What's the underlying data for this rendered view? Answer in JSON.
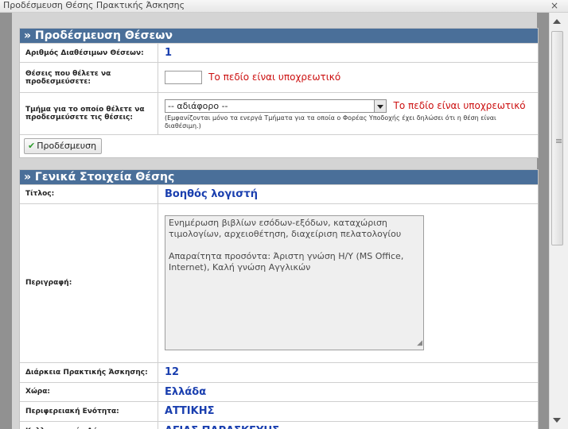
{
  "window": {
    "title": "Προδέσμευση Θέσης Πρακτικής Άσκησης",
    "close": "×"
  },
  "panel1": {
    "header": "» Προδέσμευση Θέσεων",
    "rows": [
      {
        "label": "Αριθμός Διαθέσιμων Θέσεων:",
        "value": "1"
      },
      {
        "label": "Θέσεις που θέλετε να προδεσμεύσετε:",
        "required": "Το πεδίο είναι υποχρεωτικό"
      },
      {
        "label": "Τμήμα για το οποίο θέλετε να προδεσμεύσετε τις θέσεις:",
        "select_value": "-- αδιάφορο --",
        "required": "Το πεδίο είναι υποχρεωτικό",
        "hint": "(Εμφανίζονται μόνο τα ενεργά Τμήματα για τα οποία ο Φορέας Υποδοχής έχει δηλώσει ότι η θέση είναι διαθέσιμη.)"
      }
    ],
    "button": "Προδέσμευση",
    "button_icon": "check-icon"
  },
  "panel2": {
    "header": "» Γενικά Στοιχεία Θέσης",
    "title_label": "Τίτλος:",
    "title_value": "Βοηθός λογιστή",
    "desc_label": "Περιγραφή:",
    "desc_value": "Ενημέρωση βιβλίων εσόδων-εξόδων, καταχώριση τιμολογίων, αρχειοθέτηση, διαχείριση πελατολογίου\n\nΑπαραίτητα προσόντα: Άριστη γνώση Η/Υ (MS Office, Internet), Καλή γνώση Αγγλικών",
    "duration_label": "Διάρκεια Πρακτικής Άσκησης:",
    "duration_value": "12",
    "country_label": "Χώρα:",
    "country_value": "Ελλάδα",
    "region_label": "Περιφερειακή Ενότητα:",
    "region_value": "ΑΤΤΙΚΗΣ",
    "municipality_label": "Καλλικρατικός Δήμος:",
    "municipality_value": "ΑΓΙΑΣ ΠΑΡΑΣΚΕΥΗΣ"
  },
  "colors": {
    "header": "#4a6f99",
    "value": "#1a3faf",
    "required": "#cc1010",
    "backdrop": "#919191"
  }
}
